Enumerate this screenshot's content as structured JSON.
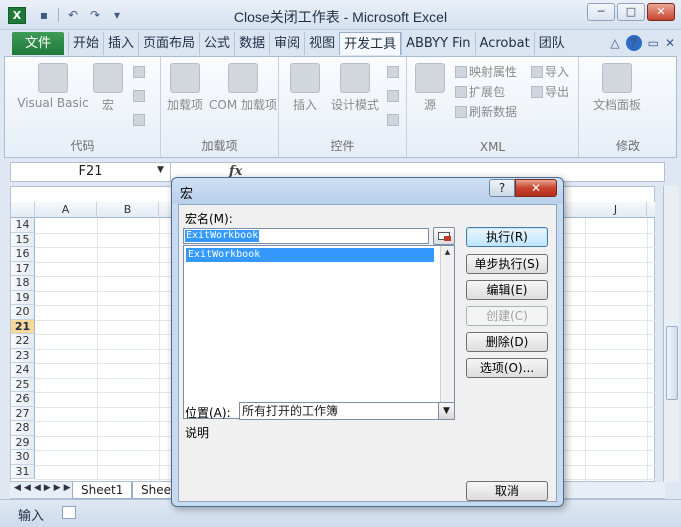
{
  "window": {
    "title": "Close关闭工作表 - Microsoft Excel",
    "logo_letter": "X",
    "controls": [
      "─",
      "□",
      "✕"
    ]
  },
  "qat": {
    "save": "▪",
    "undo": "↶",
    "redo": "↷",
    "customize": "▾"
  },
  "ribbon_tabs": {
    "file": "文件",
    "tabs": [
      "开始",
      "插入",
      "页面布局",
      "公式",
      "数据",
      "审阅",
      "视图",
      "开发工具",
      "ABBYY Fin",
      "Acrobat",
      "团队"
    ],
    "active_index": 7,
    "right_icons": [
      "△",
      "?",
      "▭",
      "✕"
    ]
  },
  "ribbon": {
    "groups": [
      {
        "label": "代码",
        "big": [
          "Visual Basic",
          "宏"
        ]
      },
      {
        "label": "加载项",
        "big": [
          "加载项",
          "COM 加载项"
        ]
      },
      {
        "label": "控件",
        "big": [
          "插入",
          "设计模式"
        ]
      },
      {
        "label": "XML",
        "big": [
          "源"
        ],
        "small": [
          "映射属性",
          "扩展包",
          "刷新数据",
          "导入",
          "导出"
        ]
      },
      {
        "label": "修改",
        "big": [
          "文档面板"
        ]
      }
    ]
  },
  "formula_bar": {
    "name_box": "F21",
    "fx": "fx"
  },
  "sheet": {
    "columns": [
      "A",
      "B",
      "J"
    ],
    "rows": [
      "14",
      "15",
      "16",
      "17",
      "18",
      "19",
      "20",
      "21",
      "22",
      "23",
      "24",
      "25",
      "26",
      "27",
      "28",
      "29",
      "30",
      "31"
    ],
    "selected_row": "21",
    "tabs": [
      "Sheet1",
      "Shee"
    ]
  },
  "status": {
    "mode": "输入"
  },
  "dialog": {
    "title": "宏",
    "help": "?",
    "close": "✕",
    "macro_name_label": "宏名(M):",
    "macro_name_value": "ExitWorkbook",
    "macros": [
      "ExitWorkbook"
    ],
    "location_label": "位置(A):",
    "location_value": "所有打开的工作簿",
    "description_label": "说明",
    "buttons": {
      "run": "执行(R)",
      "step_into": "单步执行(S)",
      "edit": "编辑(E)",
      "create": "创建(C)",
      "delete": "删除(D)",
      "options": "选项(O)...",
      "cancel": "取消"
    }
  },
  "colors": {
    "accent": "#1f7a3a",
    "selection": "#3399ff",
    "annotation_arrow": "#e00000"
  }
}
